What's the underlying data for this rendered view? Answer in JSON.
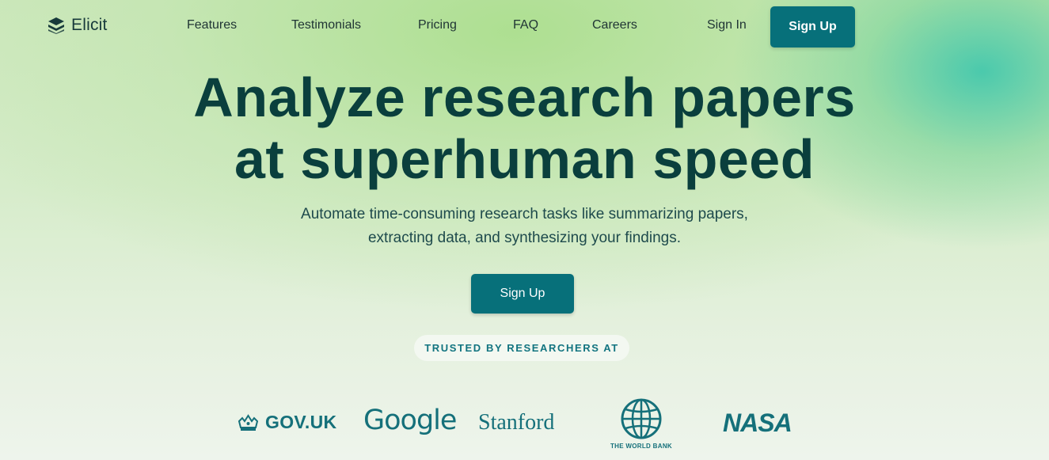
{
  "nav": {
    "brand": "Elicit",
    "links": [
      "Features",
      "Testimonials",
      "Pricing",
      "FAQ",
      "Careers"
    ],
    "sign_in": "Sign In",
    "sign_up": "Sign Up"
  },
  "hero": {
    "headline_line1": "Analyze research papers",
    "headline_line2": "at superhuman speed",
    "subhead_line1": "Automate time-consuming research tasks like summarizing papers,",
    "subhead_line2": "extracting data, and synthesizing your findings.",
    "cta": "Sign Up",
    "trusted_label": "TRUSTED BY RESEARCHERS AT"
  },
  "logos": {
    "govuk": "GOV.UK",
    "google": "Google",
    "stanford": "Stanford",
    "worldbank": "THE WORLD BANK",
    "nasa": "NASA"
  },
  "colors": {
    "accent": "#07707a",
    "headline": "#0a3f3d",
    "logo": "#15707a"
  }
}
